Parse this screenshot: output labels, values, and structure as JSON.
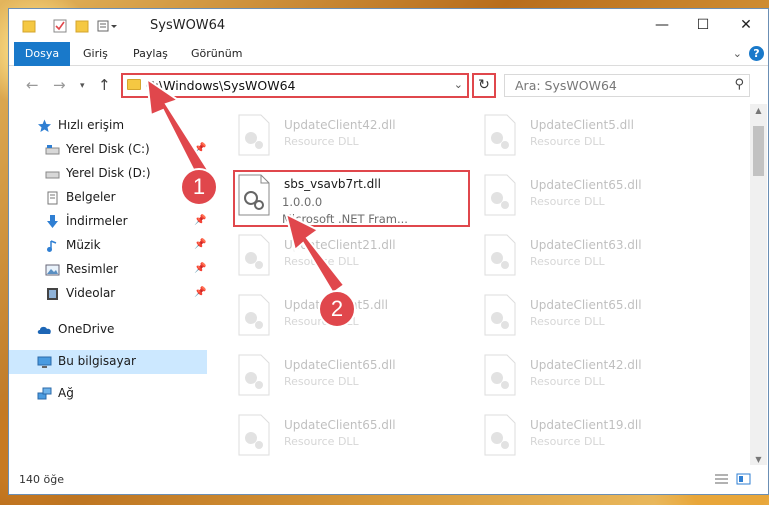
{
  "window": {
    "title": "SysWOW64"
  },
  "ribbon": {
    "tabs": [
      "Dosya",
      "Giriş",
      "Paylaş",
      "Görünüm"
    ]
  },
  "address": {
    "path": "C:\\Windows\\SysWOW64"
  },
  "search": {
    "placeholder": "Ara: SysWOW64"
  },
  "nav": {
    "items": [
      {
        "label": "Hızlı erişim",
        "icon": "star-icon"
      },
      {
        "label": "Yerel Disk (C:)",
        "icon": "drive-icon"
      },
      {
        "label": "Yerel Disk (D:)",
        "icon": "drive-icon"
      },
      {
        "label": "Belgeler",
        "icon": "document-icon"
      },
      {
        "label": "İndirmeler",
        "icon": "download-icon"
      },
      {
        "label": "Müzik",
        "icon": "music-icon"
      },
      {
        "label": "Resimler",
        "icon": "picture-icon"
      },
      {
        "label": "Videolar",
        "icon": "video-icon"
      },
      {
        "label": "OneDrive",
        "icon": "cloud-icon"
      },
      {
        "label": "Bu bilgisayar",
        "icon": "computer-icon"
      },
      {
        "label": "Ağ",
        "icon": "network-icon"
      }
    ]
  },
  "files": {
    "highlighted": {
      "name": "sbs_vsavb7rt.dll",
      "version": "1.0.0.0",
      "description": "Microsoft .NET Fram..."
    },
    "left_column": [
      {
        "name": "UpdateClient42.dll",
        "type": "Resource DLL"
      },
      {
        "name": "UpdateClient21.dll",
        "type": "Resource DLL"
      },
      {
        "name": "UpdateClient5.dll",
        "type": "Resource DLL"
      },
      {
        "name": "UpdateClient65.dll",
        "type": "Resource DLL"
      },
      {
        "name": "UpdateClient65.dll",
        "type": "Resource DLL"
      }
    ],
    "right_column": [
      {
        "name": "UpdateClient5.dll",
        "type": "Resource DLL"
      },
      {
        "name": "UpdateClient65.dll",
        "type": "Resource DLL"
      },
      {
        "name": "UpdateClient63.dll",
        "type": "Resource DLL"
      },
      {
        "name": "UpdateClient65.dll",
        "type": "Resource DLL"
      },
      {
        "name": "UpdateClient42.dll",
        "type": "Resource DLL"
      },
      {
        "name": "UpdateClient19.dll",
        "type": "Resource DLL"
      }
    ]
  },
  "status": {
    "count": "140 öğe"
  },
  "callouts": {
    "one": "1",
    "two": "2"
  },
  "colors": {
    "accent": "#1979ca",
    "callout": "#e0474c",
    "selected": "#cce8ff"
  }
}
